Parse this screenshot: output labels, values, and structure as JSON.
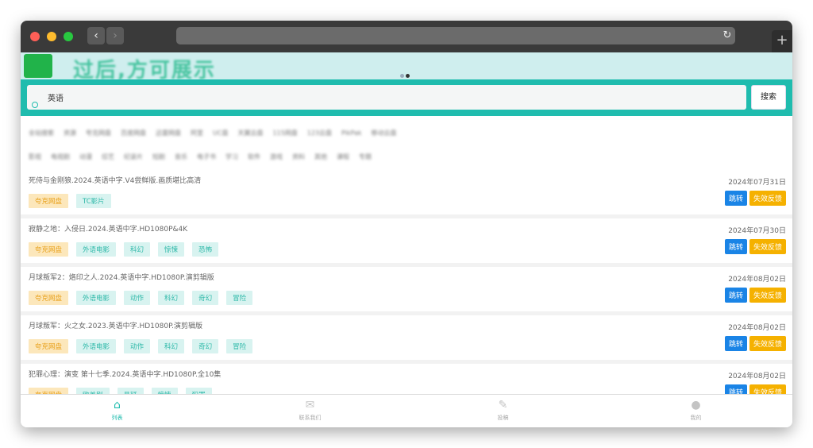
{
  "browser": {
    "back": "‹",
    "forward": "›",
    "reload": "↻",
    "new_tab": "+"
  },
  "banner": {
    "text": "过后,方可展示"
  },
  "search": {
    "value": "英语",
    "button": "搜索"
  },
  "filters": {
    "row1": [
      "全站搜索",
      "资源",
      "夸克网盘",
      "百度网盘",
      "迅雷网盘",
      "阿里",
      "UC盘",
      "天翼云盘",
      "115网盘",
      "123云盘",
      "PikPak",
      "移动云盘"
    ],
    "row2": [
      "影视",
      "电视剧",
      "动漫",
      "综艺",
      "纪录片",
      "短剧",
      "音乐",
      "电子书",
      "学习",
      "软件",
      "游戏",
      "资料",
      "其他",
      "课程",
      "专题"
    ]
  },
  "items": [
    {
      "title": "死侍与金刚狼.2024.英语中字.V4尝鲜版.画质堪比高清",
      "date": "2024年07月31日",
      "tags": [
        "夸克网盘",
        "TC影片"
      ],
      "jump": "跳转",
      "report": "失效反馈"
    },
    {
      "title": "寂静之地：入侵日.2024.英语中字.HD1080P&4K",
      "date": "2024年07月30日",
      "tags": [
        "夸克网盘",
        "外语电影",
        "科幻",
        "惊悚",
        "恐怖"
      ],
      "jump": "跳转",
      "report": "失效反馈"
    },
    {
      "title": "月球叛军2：烙印之人.2024.英语中字.HD1080P.演剪辑版",
      "date": "2024年08月02日",
      "tags": [
        "夸克网盘",
        "外语电影",
        "动作",
        "科幻",
        "奇幻",
        "冒险"
      ],
      "jump": "跳转",
      "report": "失效反馈"
    },
    {
      "title": "月球叛军：火之女.2023.英语中字.HD1080P.演剪辑版",
      "date": "2024年08月02日",
      "tags": [
        "夸克网盘",
        "外语电影",
        "动作",
        "科幻",
        "奇幻",
        "冒险"
      ],
      "jump": "跳转",
      "report": "失效反馈"
    },
    {
      "title": "犯罪心理：演变 第十七季.2024.英语中字.HD1080P.全10集",
      "date": "2024年08月02日",
      "tags": [
        "夸克网盘",
        "欧美剧",
        "悬疑",
        "惊悚",
        "犯罪"
      ],
      "jump": "跳转",
      "report": "失效反馈"
    }
  ],
  "tabbar": [
    {
      "label": "列表",
      "icon": "home-icon",
      "glyph": "⌂"
    },
    {
      "label": "联系我们",
      "icon": "mail-icon",
      "glyph": "✉"
    },
    {
      "label": "投稿",
      "icon": "edit-icon",
      "glyph": "✎"
    },
    {
      "label": "我的",
      "icon": "user-icon",
      "glyph": "●"
    }
  ],
  "colors": {
    "accent": "#1fbcae",
    "jump": "#1a84e6",
    "report": "#f5b100",
    "tag_first": "#e8a21d"
  }
}
